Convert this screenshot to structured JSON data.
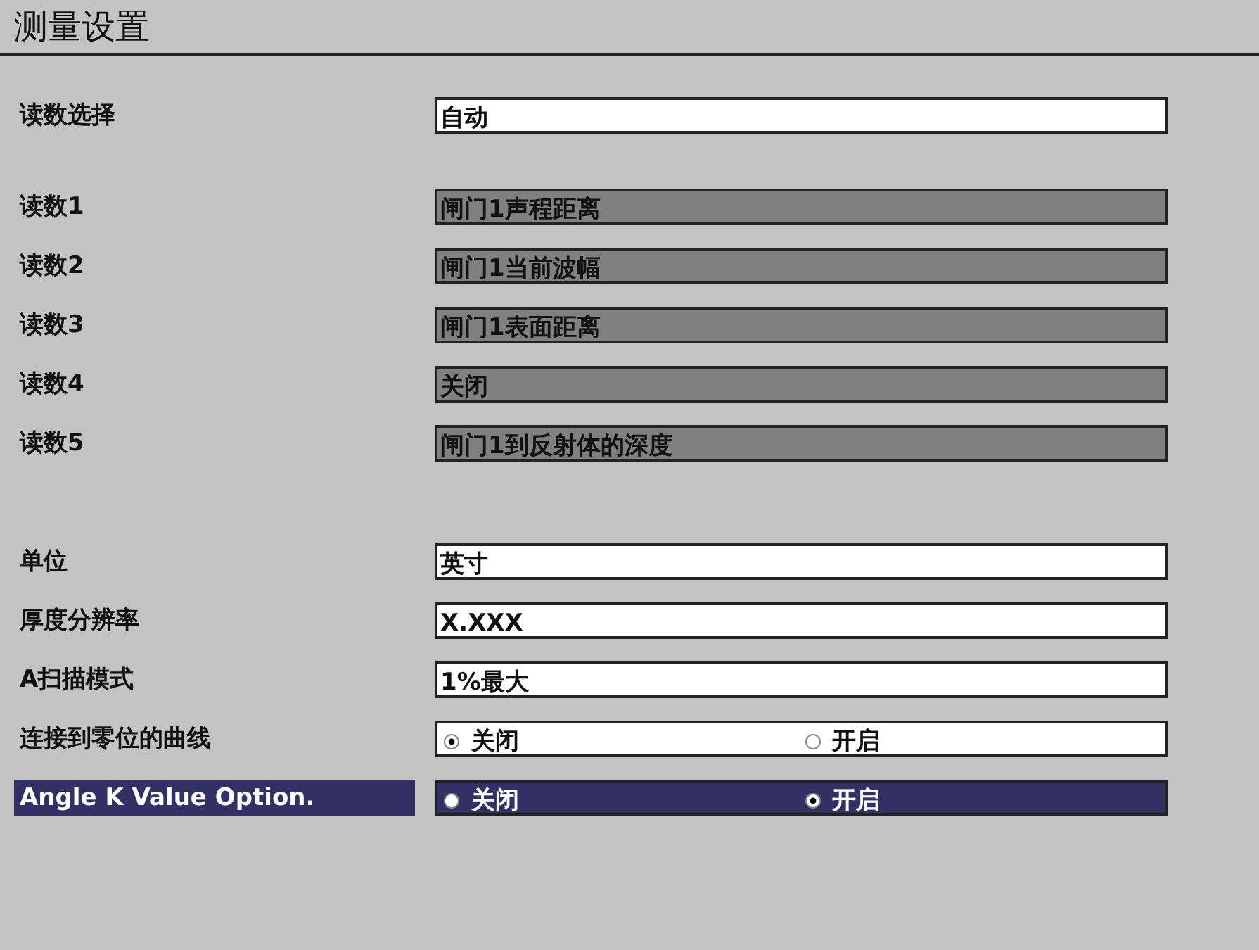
{
  "window": {
    "title": "测量设置"
  },
  "groups": [
    {
      "rows": [
        {
          "label": "读数选择",
          "kind": "field",
          "value": "自动",
          "disabled": false,
          "selected": false
        }
      ]
    },
    {
      "rows": [
        {
          "label": "读数1",
          "kind": "field",
          "value": "闸门1声程距离",
          "disabled": true,
          "selected": false
        },
        {
          "label": "读数2",
          "kind": "field",
          "value": "闸门1当前波幅",
          "disabled": true,
          "selected": false
        },
        {
          "label": "读数3",
          "kind": "field",
          "value": "闸门1表面距离",
          "disabled": true,
          "selected": false
        },
        {
          "label": "读数4",
          "kind": "field",
          "value": "关闭",
          "disabled": true,
          "selected": false
        },
        {
          "label": "读数5",
          "kind": "field",
          "value": "闸门1到反射体的深度",
          "disabled": true,
          "selected": false
        }
      ]
    },
    {
      "rows": [
        {
          "label": "单位",
          "kind": "field",
          "value": "英寸",
          "disabled": false,
          "selected": false
        },
        {
          "label": "厚度分辨率",
          "kind": "field",
          "value": "X.XXX",
          "disabled": false,
          "selected": false
        },
        {
          "label": "A扫描模式",
          "kind": "field",
          "value": "1%最大",
          "disabled": false,
          "selected": false
        },
        {
          "label": "连接到零位的曲线",
          "kind": "radio",
          "options": [
            {
              "label": "关闭",
              "selected": true
            },
            {
              "label": "开启",
              "selected": false
            }
          ],
          "disabled": false,
          "selected": false
        },
        {
          "label": "Angle K Value Option.",
          "kind": "radio",
          "options": [
            {
              "label": "关闭",
              "selected": false
            },
            {
              "label": "开启",
              "selected": true
            }
          ],
          "disabled": false,
          "selected": true
        }
      ]
    }
  ]
}
